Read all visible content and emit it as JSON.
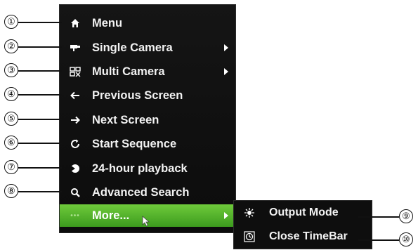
{
  "menu": {
    "items": [
      {
        "label": "Menu",
        "icon": "home-icon"
      },
      {
        "label": "Single Camera",
        "icon": "camera-icon",
        "has_submenu": true
      },
      {
        "label": "Multi Camera",
        "icon": "multi-camera-icon",
        "has_submenu": true
      },
      {
        "label": "Previous Screen",
        "icon": "arrow-left-icon"
      },
      {
        "label": "Next Screen",
        "icon": "arrow-right-icon"
      },
      {
        "label": "Start Sequence",
        "icon": "refresh-icon"
      },
      {
        "label": "24-hour playback",
        "icon": "playback-icon"
      },
      {
        "label": "Advanced Search",
        "icon": "search-icon"
      },
      {
        "label": "More...",
        "icon": "dots-icon",
        "has_submenu": true,
        "highlighted": true
      }
    ]
  },
  "submenu": {
    "items": [
      {
        "label": "Output Mode",
        "icon": "output-mode-icon"
      },
      {
        "label": "Close TimeBar",
        "icon": "clock-icon"
      }
    ]
  },
  "callouts": [
    "①",
    "②",
    "③",
    "④",
    "⑤",
    "⑥",
    "⑦",
    "⑧",
    "⑨",
    "⑩"
  ],
  "colors": {
    "menu_bg": "#111111",
    "highlight": "#4caf2a",
    "text": "#f2f2f2"
  }
}
